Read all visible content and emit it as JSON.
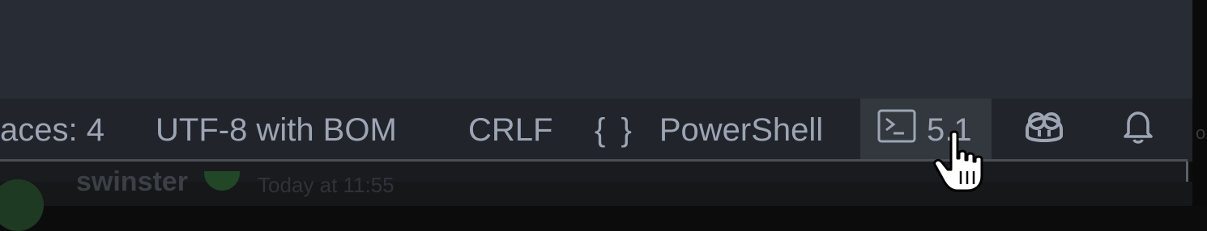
{
  "statusbar": {
    "spaces_label": "aces: 4",
    "encoding_label": "UTF-8 with BOM",
    "eol_label": "CRLF",
    "language_icon": "{ }",
    "language_label": "PowerShell",
    "ps_version_label": "5.1",
    "copilot_icon": "copilot-icon",
    "bell_icon": "bell-icon",
    "terminal_icon": "terminal-icon"
  },
  "behind": {
    "username": "swinster",
    "timestamp": "Today at 11:55"
  }
}
